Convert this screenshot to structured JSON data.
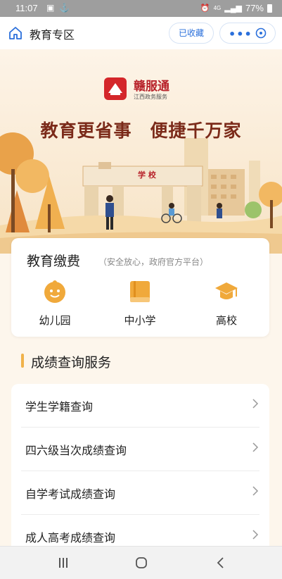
{
  "status": {
    "time": "11:07",
    "network": "4G",
    "battery": "77%"
  },
  "header": {
    "title": "教育专区",
    "favorite_label": "已收藏"
  },
  "banner": {
    "logo_name": "赣服通",
    "logo_sub": "江西政务服务",
    "slogan": "教育更省事　便捷千万家",
    "school_sign": "学 校"
  },
  "payment": {
    "title": "教育缴费",
    "subtitle": "（安全放心，政府官方平台）",
    "items": [
      {
        "label": "幼儿园",
        "icon": "baby-face-icon"
      },
      {
        "label": "中小学",
        "icon": "book-icon"
      },
      {
        "label": "高校",
        "icon": "graduation-cap-icon"
      }
    ]
  },
  "scores": {
    "title": "成绩查询服务",
    "items": [
      {
        "label": "学生学籍查询"
      },
      {
        "label": "四六级当次成绩查询"
      },
      {
        "label": "自学考试成绩查询"
      },
      {
        "label": "成人高考成绩查询"
      }
    ]
  },
  "colors": {
    "accent": "#f0a93b",
    "link_blue": "#2a6fdb",
    "brand_red": "#d4262a"
  }
}
